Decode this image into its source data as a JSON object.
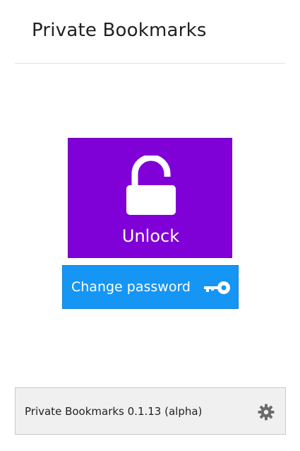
{
  "header": {
    "title": "Private Bookmarks"
  },
  "unlock_tile": {
    "label": "Unlock",
    "icon": "unlocked-padlock-icon",
    "color": "#8000d8"
  },
  "change_password": {
    "label": "Change password",
    "icon": "key-icon",
    "color": "#1596f5"
  },
  "footer": {
    "version_text": "Private Bookmarks 0.1.13 (alpha)",
    "settings_icon": "gear-icon"
  }
}
